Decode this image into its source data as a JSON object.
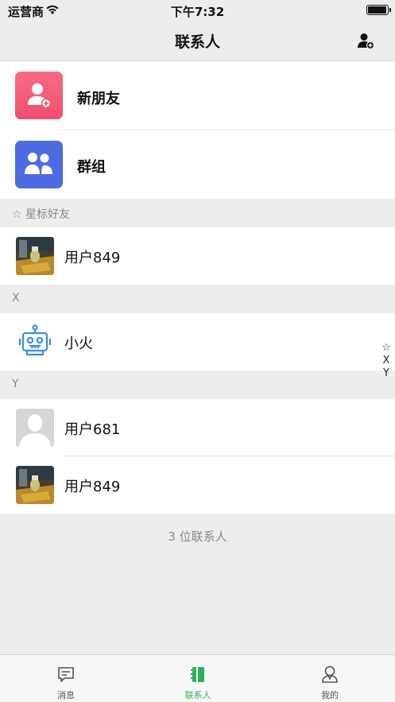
{
  "status_bar": {
    "carrier": "运营商",
    "time": "下午7:32",
    "battery_level": 0.95
  },
  "nav": {
    "title": "联系人"
  },
  "shortcuts": [
    {
      "label": "新朋友"
    },
    {
      "label": "群组"
    }
  ],
  "sections": [
    {
      "title": "☆ 星标好友",
      "contacts": [
        {
          "name": "用户849"
        }
      ]
    },
    {
      "title": "X",
      "contacts": [
        {
          "name": "小火"
        }
      ]
    },
    {
      "title": "Y",
      "contacts": [
        {
          "name": "用户681"
        },
        {
          "name": "用户849"
        }
      ]
    }
  ],
  "index": [
    "☆",
    "X",
    "Y"
  ],
  "footer": {
    "count_text": "3 位联系人"
  },
  "tabs": [
    {
      "label": "消息",
      "active": false
    },
    {
      "label": "联系人",
      "active": true
    },
    {
      "label": "我的",
      "active": false
    }
  ],
  "colors": {
    "accent": "#2fb257",
    "new_friend_tile": "#f0506d",
    "group_tile": "#4d6be3",
    "robot": "#3a8fd8"
  }
}
